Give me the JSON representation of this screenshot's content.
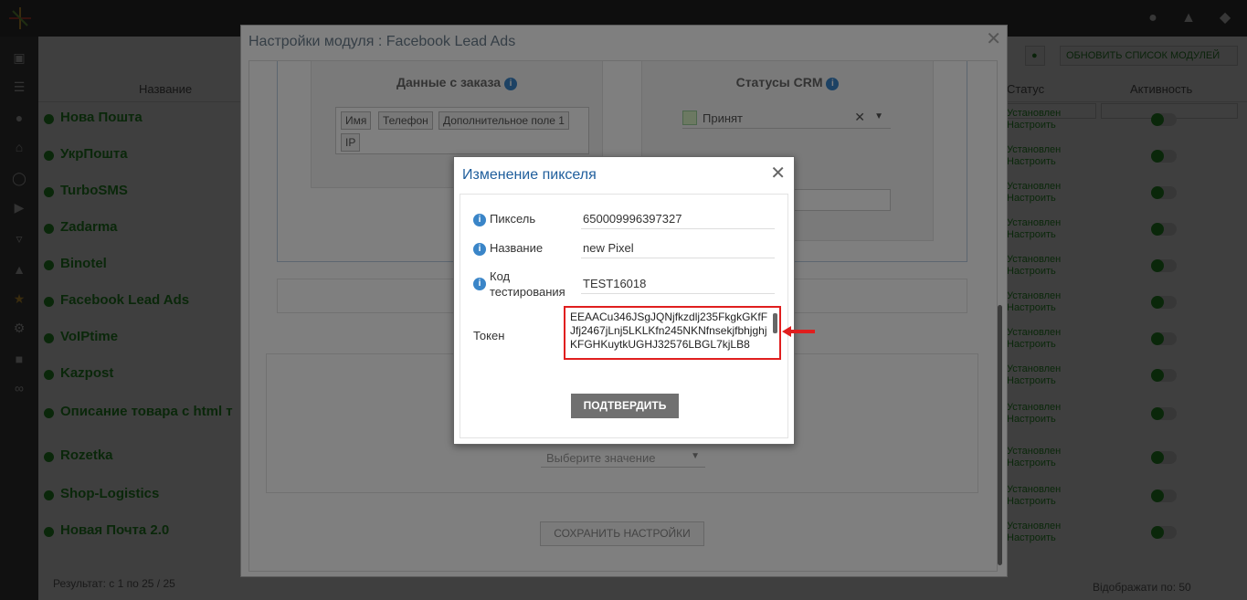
{
  "background": {
    "columns": {
      "name": "Название",
      "status": "Статус",
      "activity": "Активность"
    },
    "toolbar": {
      "refresh_label": "ОБНОВИТЬ СПИСОК МОДУЛЕЙ"
    },
    "modules": [
      {
        "name": "Нова Пошта",
        "status": "Установлен Настроить"
      },
      {
        "name": "УкрПошта",
        "status": "Установлен Настроить"
      },
      {
        "name": "TurboSMS",
        "status": "Установлен Настроить"
      },
      {
        "name": "Zadarma",
        "status": "Установлен Настроить"
      },
      {
        "name": "Binotel",
        "status": "Установлен Настроить"
      },
      {
        "name": "Facebook Lead Ads",
        "status": "Установлен Настроить"
      },
      {
        "name": "VoIPtime",
        "status": "Установлен Настроить"
      },
      {
        "name": "Kazpost",
        "status": "Установлен Настроить"
      },
      {
        "name": "Описание товара с html т",
        "status": "Установлен Настроить"
      },
      {
        "name": "Rozetka",
        "status": "Установлен Настроить"
      },
      {
        "name": "Shop-Logistics",
        "status": "Установлен Настроить"
      },
      {
        "name": "Новая Почта 2.0",
        "status": "Установлен Настроить"
      }
    ],
    "footer": {
      "result": "Результат: с 1 по 25 / 25",
      "per_page": "Відображати по: 50"
    }
  },
  "module_window": {
    "title": "Настройки модуля : Facebook Lead Ads",
    "order_data_title": "Данные с заказа",
    "order_tags": [
      "Имя",
      "Телефон",
      "Дополнительное поле 1",
      "IP"
    ],
    "crm_status_title": "Статусы CRM",
    "crm_status_value": "Принят",
    "select_placeholder": "Выберите значение",
    "save_label": "СОХРАНИТЬ НАСТРОЙКИ"
  },
  "pixel_dialog": {
    "title": "Изменение пикселя",
    "fields": {
      "pixel_label": "Пиксель",
      "pixel_value": "650009996397327",
      "name_label": "Название",
      "name_value": "new Pixel",
      "testcode_label": "Код тестирования",
      "testcode_value": "TEST16018",
      "token_label": "Токен",
      "token_value": "EEAACu346JSgJQNjfkzdlj235FkgkGKfFJfj2467jLnj5LKLKfn245NKNfnsekjfbhjghjKFGHKuytkUGHJ32576LBGL7kjLB8"
    },
    "confirm_label": "ПОДТВЕРДИТЬ"
  },
  "colors": {
    "accent_green": "#2a9d2a",
    "highlight_red": "#e01e1e",
    "title_blue": "#1f5e9c"
  }
}
